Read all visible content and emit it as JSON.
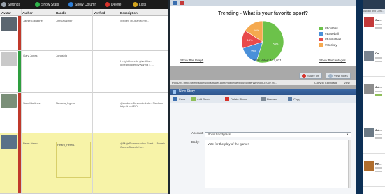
{
  "left": {
    "toolbar": {
      "items": [
        {
          "label": "Settings",
          "color": "#9aa3ad"
        },
        {
          "label": "Show Stats",
          "color": "#2fb24a"
        },
        {
          "label": "Show Column",
          "color": "#2f7fd8"
        },
        {
          "label": "Delete",
          "color": "#d6332b"
        },
        {
          "label": "Lists",
          "color": "#d3a51f"
        }
      ]
    },
    "columns": [
      "Avatar",
      "Author",
      "Handle",
      "Verified",
      "Description"
    ],
    "rows": [
      {
        "author": "Jamie Gallagher",
        "handle": "JimGallagher",
        "verified": "",
        "description": "@Riley @Dean Kimb...",
        "stripe": "#c0392b",
        "avatar": "#5b6670",
        "bg": "#ffffff"
      },
      {
        "author": "Gary Jones",
        "handle": "Jonnsbig",
        "verified": "",
        "description": "I might have to give this... #MeanongetMyWanna 4 ...",
        "stripe": "#2e9e3f",
        "avatar": "#c9c9c9",
        "bg": "#ffffff"
      },
      {
        "author": "Sam Martinez",
        "handle": "Nevada_legend",
        "verified": "",
        "description": "@AndrewStewardo Luk... Stadium http://t.co/tFiD...",
        "stripe": "#c0392b",
        "avatar": "#7a8f78",
        "bg": "#ffffff"
      },
      {
        "author": "Peter Heard",
        "handle": "Heard_Peter1",
        "verified": "",
        "description": "@MajeStoneshadow Forst... Rudeis Cones 3 week ho...",
        "stripe": "#c0392b",
        "avatar": "#5a7288",
        "bg": "#f7f3a8"
      }
    ]
  },
  "chart": {
    "window_title": "",
    "links": {
      "left": "Show Bar Graph",
      "middle": "Total Votes: 177,071",
      "right": "Show Percentages"
    },
    "footer": {
      "url": "Poll URL: http://www.sportspollsmaker.com/mobilewebpoll/TwitterWinPollID=00778 ...",
      "copy": "Copy to Clipboard",
      "view": "View"
    },
    "actions": {
      "share": "Share On",
      "view_votes": "View Votes"
    }
  },
  "chart_data": {
    "type": "pie",
    "title": "Trending - What is your favorite sport?",
    "categories": [
      "#Football",
      "#Baseball",
      "#Basketball",
      "#Hockey"
    ],
    "values": [
      55,
      15,
      14,
      16
    ],
    "colors": [
      "#6cc24a",
      "#4a90d9",
      "#e84a4a",
      "#f5a94f"
    ],
    "slice_labels": [
      "55%",
      "15%",
      "14%",
      "16%"
    ],
    "legend_position": "right"
  },
  "story": {
    "title": "New Story",
    "toolbar": [
      "Save",
      "Add Photo",
      "Delete Photo",
      "Preview",
      "Copy"
    ],
    "account_label": "Account:",
    "account_value": "Ross Snodgrass",
    "body_label": "Body:",
    "body_text": "Vote for the play of the game!"
  },
  "right": {
    "subtitle": "Ask Bo and Cow...",
    "items": [
      {
        "title": "Co...",
        "thumb": "#c43a3a"
      },
      {
        "title": "Co...",
        "thumb": "#7a8490"
      },
      {
        "title": "Jai...",
        "thumb": "#8e8e8e"
      },
      {
        "title": "Jai...",
        "thumb": "#6c7a86"
      },
      {
        "title": "Ke...",
        "thumb": "#b06e2e"
      }
    ]
  }
}
